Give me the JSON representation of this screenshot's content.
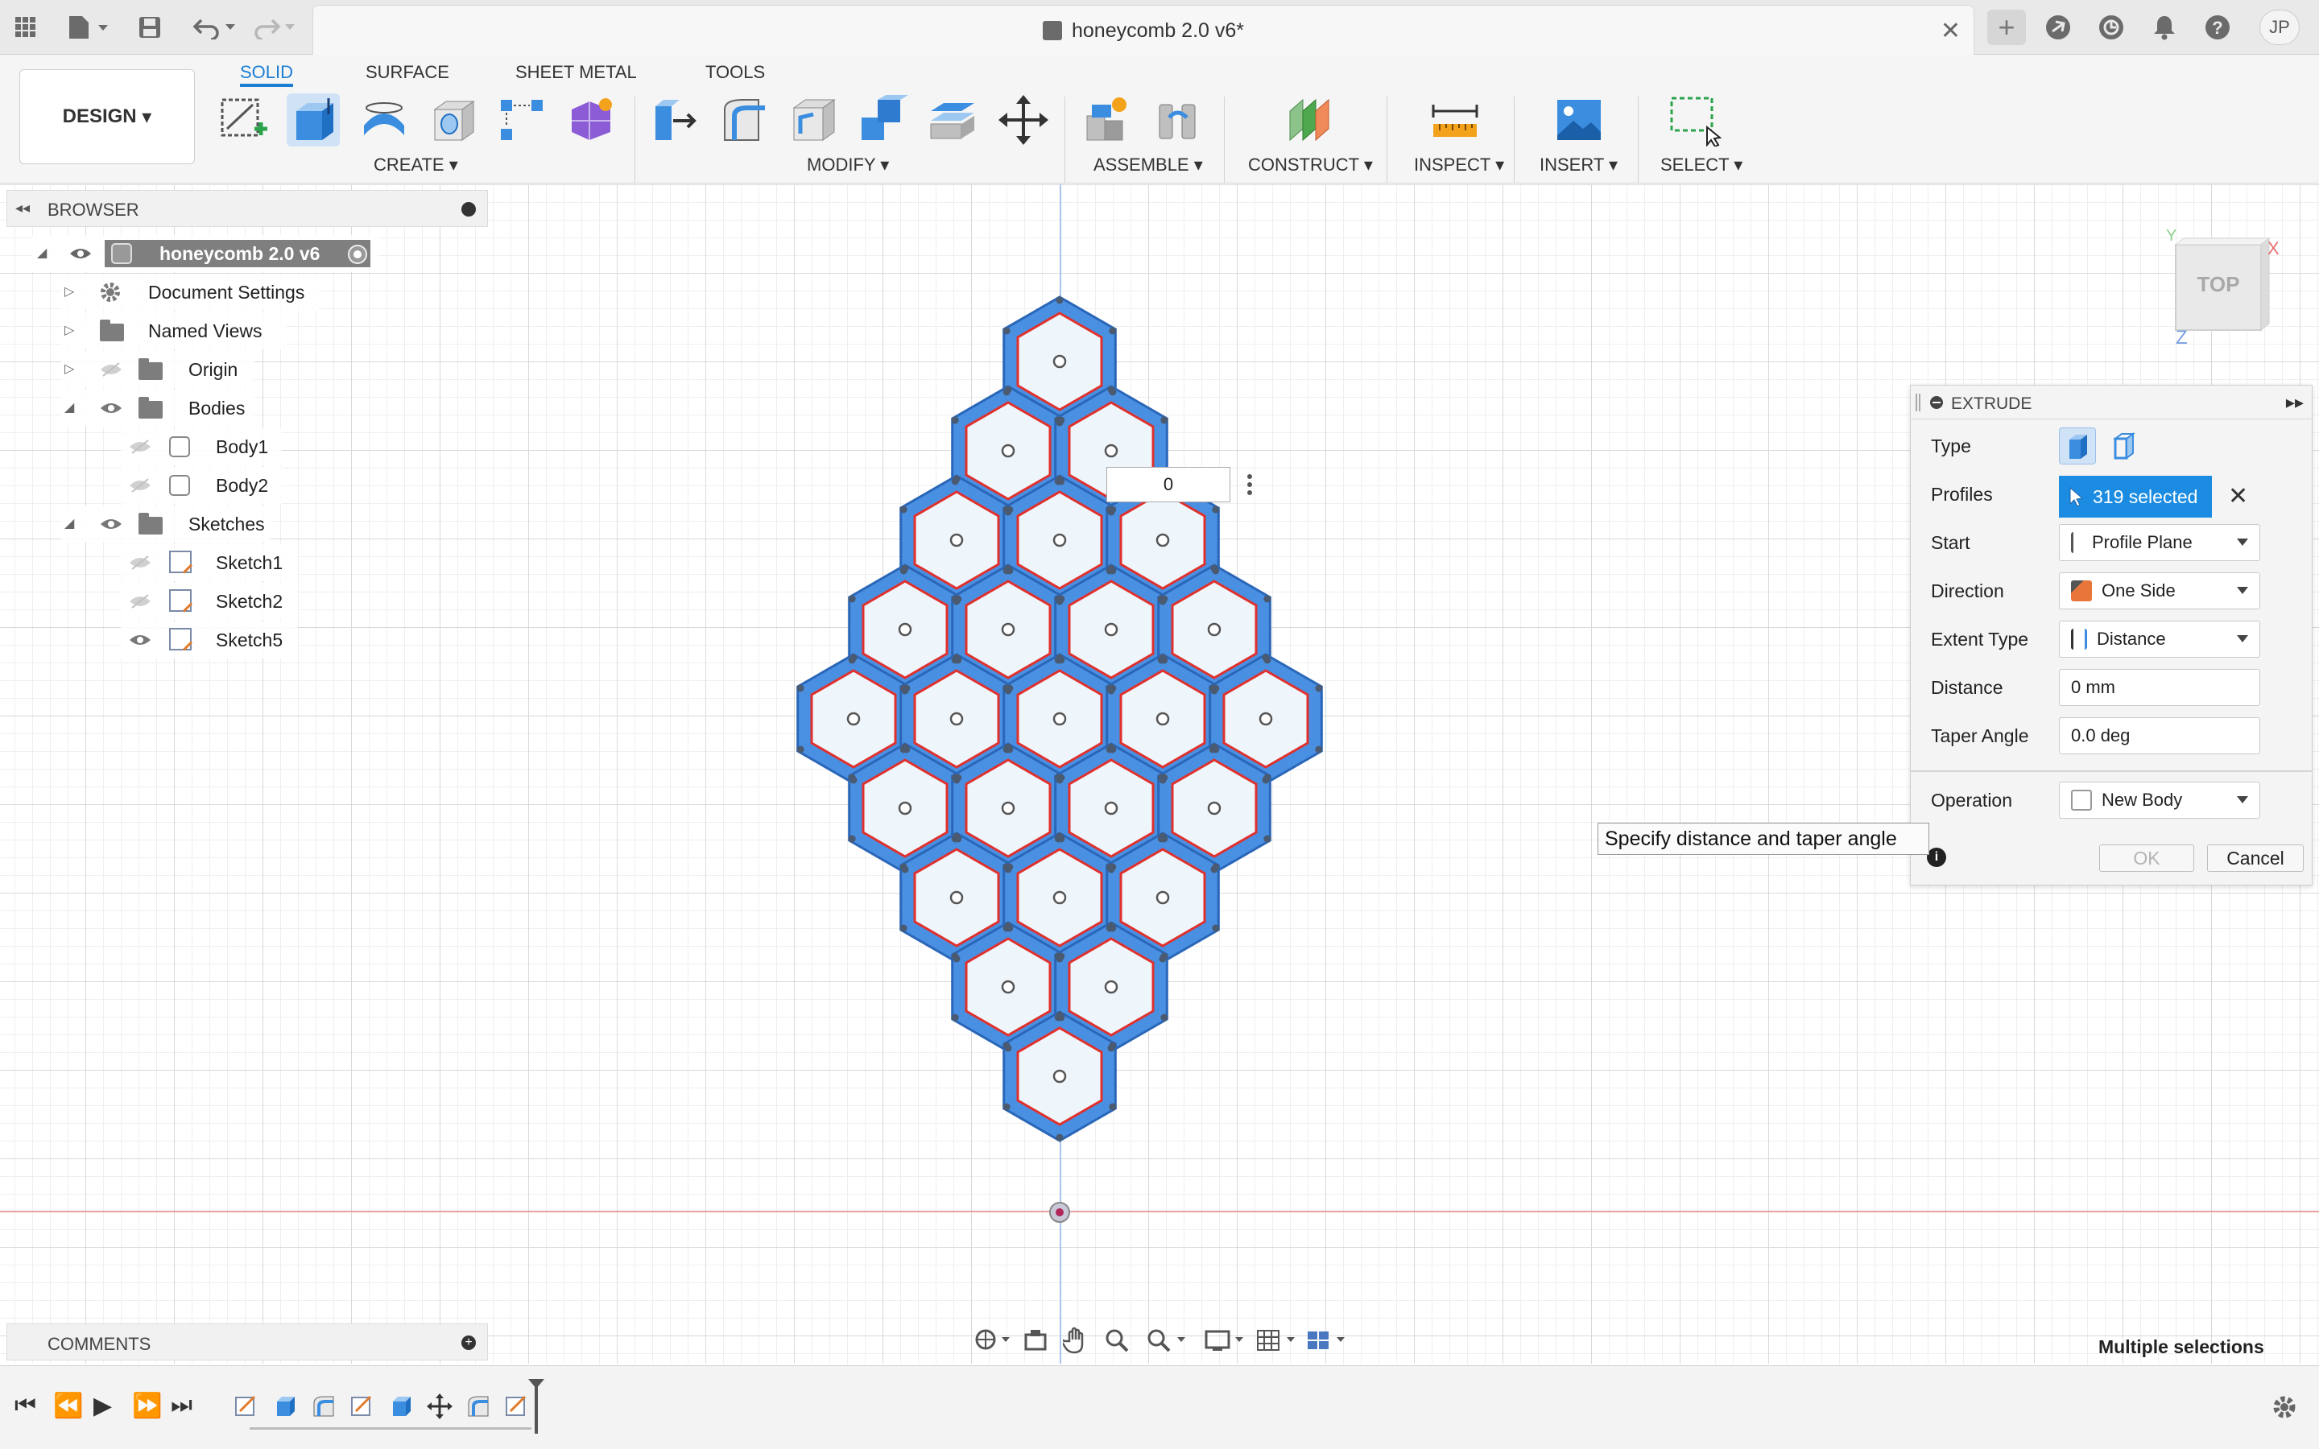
{
  "document": {
    "title": "honeycomb 2.0 v6*"
  },
  "user": {
    "initials": "JP"
  },
  "workspace": {
    "mode_button": "DESIGN",
    "tabs": [
      "SOLID",
      "SURFACE",
      "SHEET METAL",
      "TOOLS"
    ],
    "active_tab": "SOLID",
    "groups": [
      "CREATE",
      "MODIFY",
      "ASSEMBLE",
      "CONSTRUCT",
      "INSPECT",
      "INSERT",
      "SELECT"
    ]
  },
  "browser": {
    "title": "BROWSER",
    "root": "honeycomb 2.0 v6",
    "items": [
      {
        "label": "Document Settings"
      },
      {
        "label": "Named Views"
      },
      {
        "label": "Origin"
      },
      {
        "label": "Bodies"
      },
      {
        "label": "Body1"
      },
      {
        "label": "Body2"
      },
      {
        "label": "Sketches"
      },
      {
        "label": "Sketch1"
      },
      {
        "label": "Sketch2"
      },
      {
        "label": "Sketch5"
      }
    ]
  },
  "viewcube": {
    "face": "TOP",
    "axis_x": "X",
    "axis_y": "Y",
    "axis_z": "Z"
  },
  "canvas": {
    "distance_input": "0"
  },
  "extrude": {
    "title": "EXTRUDE",
    "type_label": "Type",
    "profiles_label": "Profiles",
    "profiles_value": "319 selected",
    "start_label": "Start",
    "start_value": "Profile Plane",
    "direction_label": "Direction",
    "direction_value": "One Side",
    "extent_label": "Extent Type",
    "extent_value": "Distance",
    "distance_label": "Distance",
    "distance_value": "0 mm",
    "taper_label": "Taper Angle",
    "taper_value": "0.0 deg",
    "operation_label": "Operation",
    "operation_value": "New Body",
    "ok": "OK",
    "cancel": "Cancel"
  },
  "tooltip": "Specify distance and taper angle",
  "comments": {
    "title": "COMMENTS"
  },
  "status": {
    "right_text": "Multiple selections"
  },
  "colors": {
    "accent": "#1a7ed4",
    "profile_fill": "#4a90e2",
    "profile_edge": "#e0302c"
  }
}
